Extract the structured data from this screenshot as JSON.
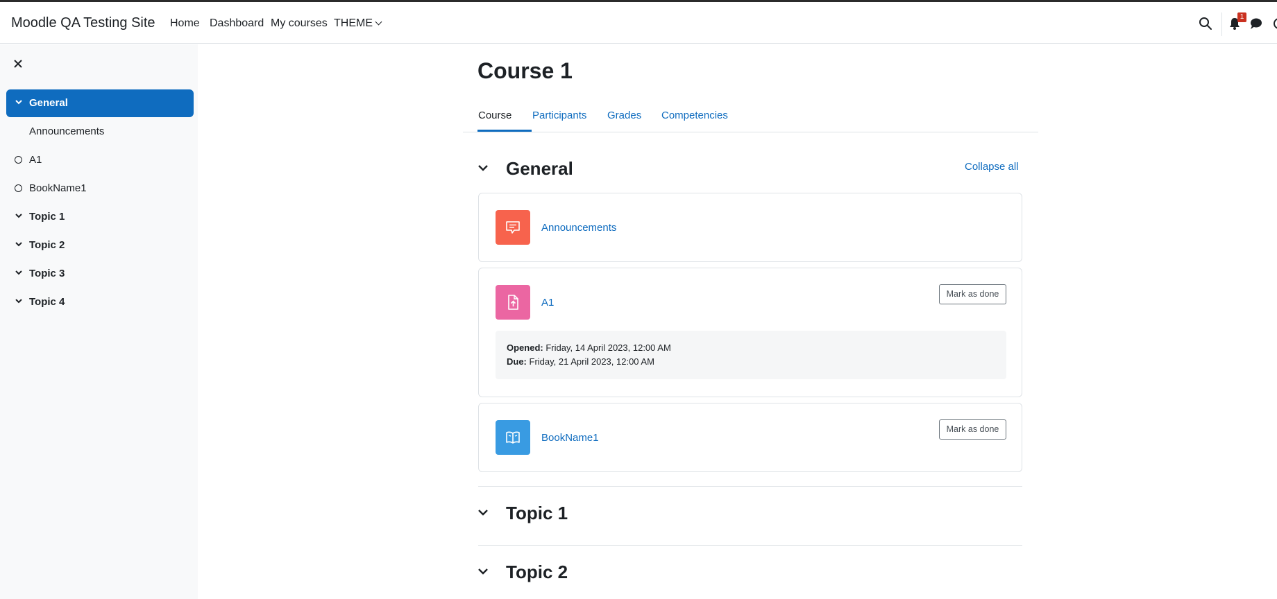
{
  "navbar": {
    "brand": "Moodle QA Testing Site",
    "links": [
      "Home",
      "Dashboard",
      "My courses",
      "THEME"
    ],
    "icons": [
      "search-icon",
      "bell-icon",
      "chat-icon"
    ],
    "notification_count": "1"
  },
  "drawer": {
    "close_icon": "close-icon",
    "items": [
      {
        "label": "General",
        "kind": "section",
        "active": true
      },
      {
        "label": "Announcements",
        "kind": "activity"
      },
      {
        "label": "A1",
        "kind": "activity-incomplete"
      },
      {
        "label": "BookName1",
        "kind": "activity-incomplete"
      },
      {
        "label": "Topic 1",
        "kind": "section"
      },
      {
        "label": "Topic 2",
        "kind": "section"
      },
      {
        "label": "Topic 3",
        "kind": "section"
      },
      {
        "label": "Topic 4",
        "kind": "section"
      }
    ]
  },
  "course": {
    "title": "Course 1",
    "tabs": [
      {
        "label": "Course",
        "active": true
      },
      {
        "label": "Participants"
      },
      {
        "label": "Grades"
      },
      {
        "label": "Competencies"
      }
    ],
    "collapse_all": "Collapse all",
    "sections": [
      {
        "title": "General",
        "activities": [
          {
            "name": "Announcements",
            "icon": "forum-icon",
            "color": "#f7634d"
          },
          {
            "name": "A1",
            "icon": "assignment-icon",
            "color": "#eb66a2",
            "button": "Mark as done",
            "dates": [
              {
                "label": "Opened:",
                "value": "Friday, 14 April 2023, 12:00 AM"
              },
              {
                "label": "Due:",
                "value": "Friday, 21 April 2023, 12:00 AM"
              }
            ]
          },
          {
            "name": "BookName1",
            "icon": "book-icon",
            "color": "#399be2",
            "button": "Mark as done"
          }
        ]
      },
      {
        "title": "Topic 1"
      },
      {
        "title": "Topic 2"
      }
    ]
  }
}
